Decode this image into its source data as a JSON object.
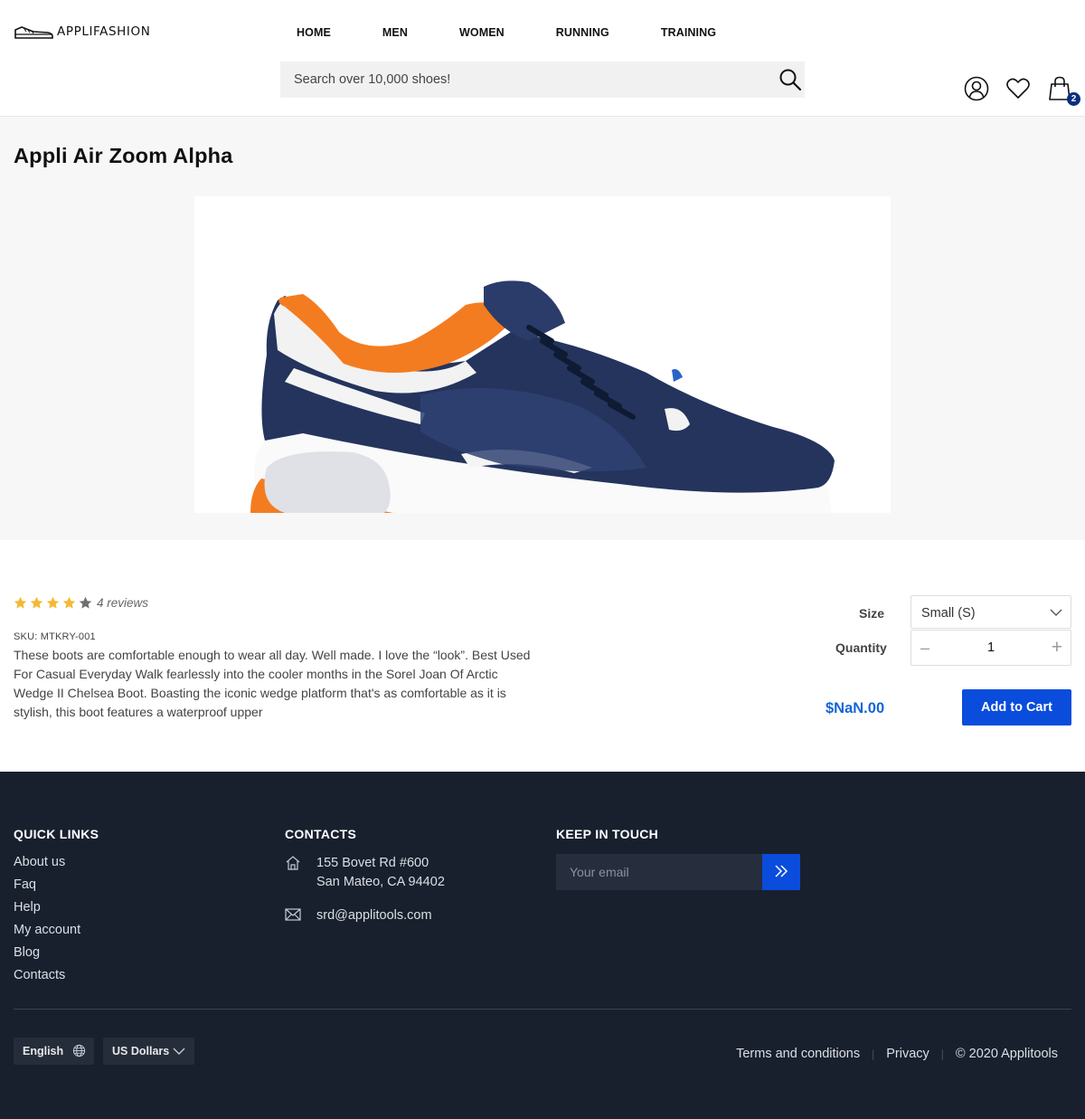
{
  "header": {
    "brand": "APPLIFASHION",
    "nav": [
      "HOME",
      "MEN",
      "WOMEN",
      "RUNNING",
      "TRAINING"
    ],
    "search_placeholder": "Search over 10,000 shoes!",
    "cart_count": "2",
    "icons": [
      "user-icon",
      "heart-icon",
      "cart-icon",
      "search-icon"
    ]
  },
  "product": {
    "title": "Appli Air Zoom Alpha",
    "rating": 4,
    "rating_max": 5,
    "reviews": "4 reviews",
    "sku": "SKU: MTKRY-001",
    "description": "These boots are comfortable enough to wear all day. Well made. I love the “look”. Best Used For Casual Everyday Walk fearlessly into the cooler months in the Sorel Joan Of Arctic Wedge II Chelsea Boot. Boasting the iconic wedge platform that's as comfortable as it is stylish, this boot features a waterproof upper",
    "size_label": "Size",
    "size_value": "Small (S)",
    "quantity_label": "Quantity",
    "quantity_value": "1",
    "price": "$NaN.00",
    "add_to_cart": "Add to Cart",
    "colors": {
      "star": "#f5b830",
      "star_empty": "#6f6f6f",
      "price": "#1565d8",
      "button": "#0a4cdb"
    }
  },
  "footer": {
    "quick_links_title": "QUICK LINKS",
    "quick_links": [
      "About us",
      "Faq",
      "Help",
      "My account",
      "Blog",
      "Contacts"
    ],
    "contacts_title": "CONTACTS",
    "address_line1": "155 Bovet Rd #600",
    "address_line2": "San Mateo, CA 94402",
    "email": "srd@applitools.com",
    "keep_in_touch_title": "KEEP IN TOUCH",
    "email_placeholder": "Your email",
    "language": "English",
    "currency": "US Dollars",
    "terms": "Terms and conditions",
    "privacy": "Privacy",
    "copyright": "© 2020 Applitools",
    "colors": {
      "background": "#18202e"
    }
  }
}
